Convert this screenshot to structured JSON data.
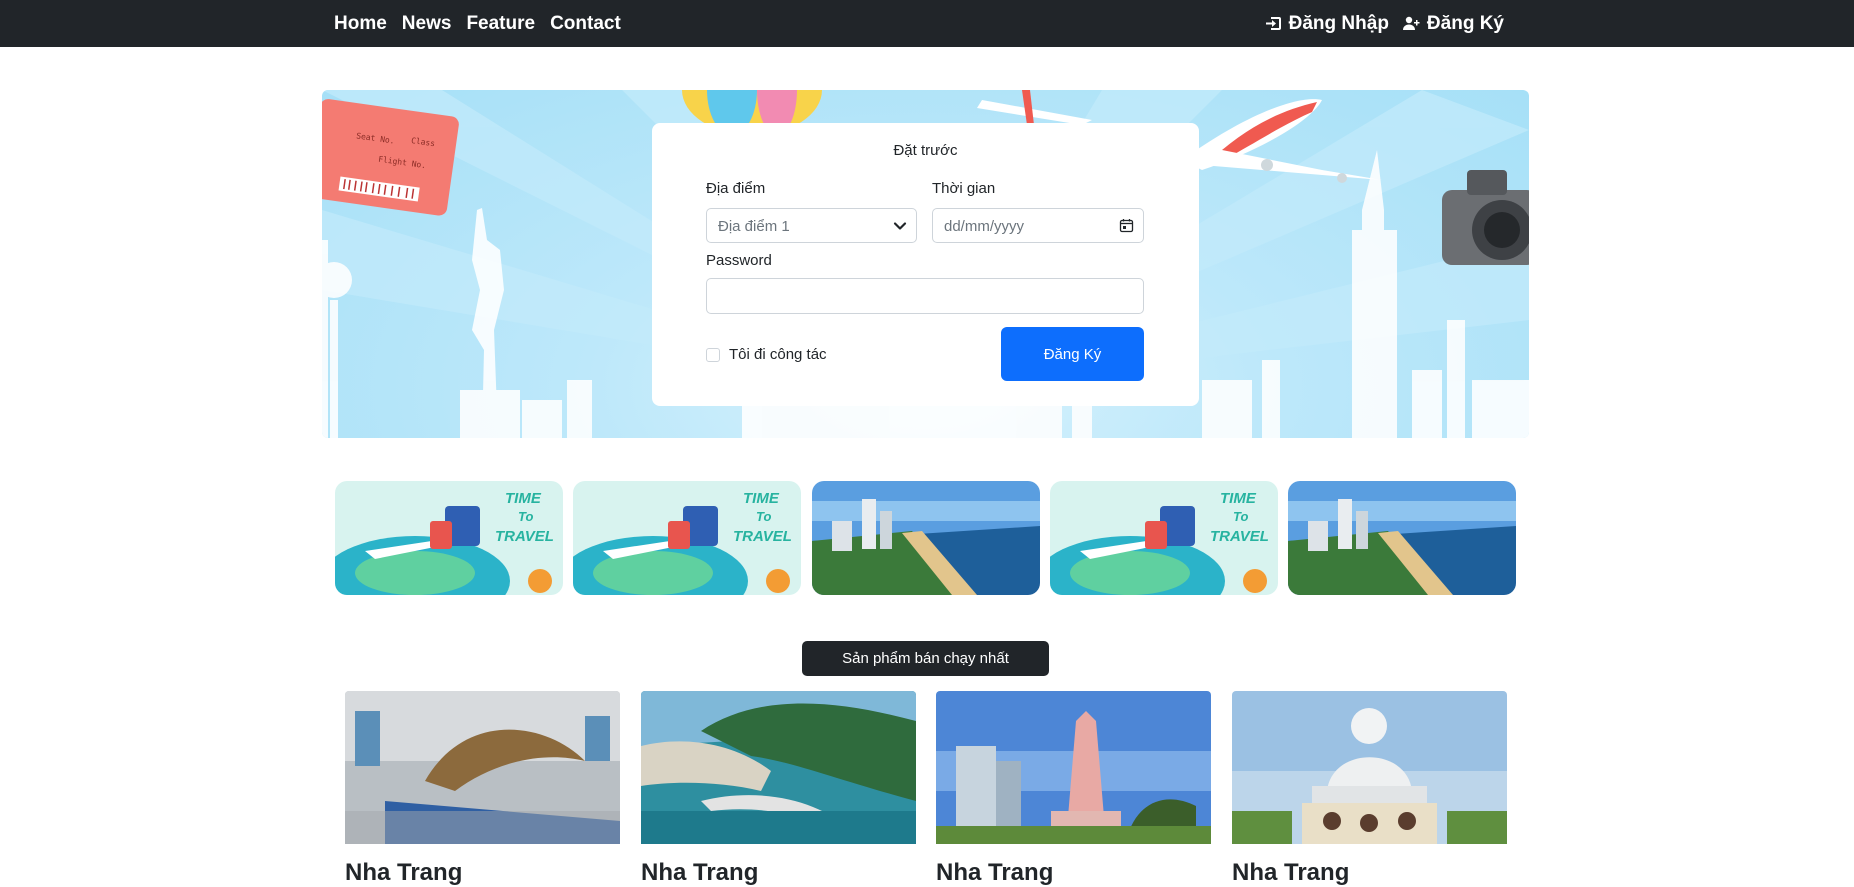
{
  "nav": {
    "links": [
      "Home",
      "News",
      "Feature",
      "Contact"
    ],
    "login_label": "Đăng Nhập",
    "register_label": "Đăng Ký",
    "login_icon": "sign-in-icon",
    "register_icon": "user-plus-icon"
  },
  "booking": {
    "title": "Đặt trước",
    "location_label": "Địa điểm",
    "location_selected": "Địa điểm 1",
    "time_label": "Thời gian",
    "date_placeholder": "dd/mm/yyyy",
    "password_label": "Password",
    "password_value": "",
    "business_trip_label": "Tôi đi công tác",
    "business_trip_checked": false,
    "submit_label": "Đăng Ký"
  },
  "hero": {
    "ticket_text": [
      "Seat No.",
      "Class",
      "Flight No."
    ]
  },
  "carousel": {
    "thumbs": [
      {
        "type": "travel-poster",
        "text": [
          "TIME",
          "To",
          "TRAVEL"
        ]
      },
      {
        "type": "travel-poster",
        "text": [
          "TIME",
          "To",
          "TRAVEL"
        ]
      },
      {
        "type": "beach-city"
      },
      {
        "type": "travel-poster",
        "text": [
          "TIME",
          "To",
          "TRAVEL"
        ]
      },
      {
        "type": "beach-city"
      }
    ]
  },
  "bestseller": {
    "label": "Sản phẩm bán chạy nhất",
    "products": [
      {
        "title": "Nha Trang",
        "photo": "museum-whale-skeleton"
      },
      {
        "title": "Nha Trang",
        "photo": "bay-aerial"
      },
      {
        "title": "Nha Trang",
        "photo": "tower-monument"
      },
      {
        "title": "Nha Trang",
        "photo": "white-buddha-statue"
      }
    ]
  },
  "colors": {
    "navbar": "#212529",
    "primary": "#0d6efd",
    "hero_sky": "#a6e0f7"
  }
}
